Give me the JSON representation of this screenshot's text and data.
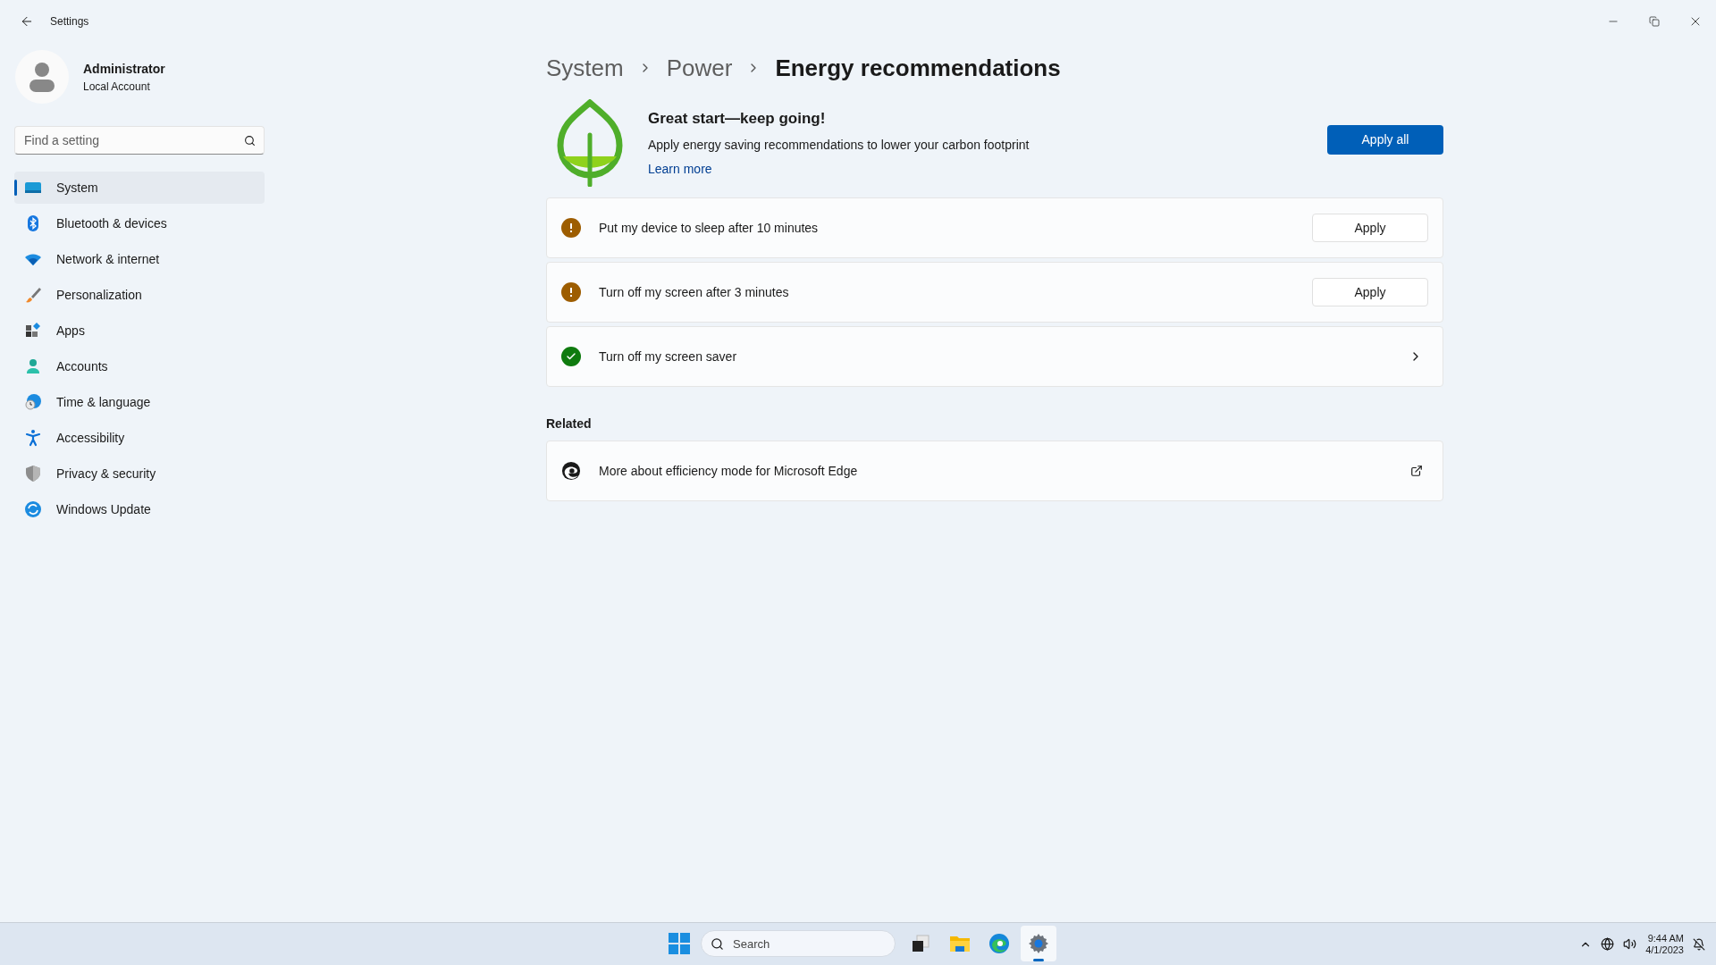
{
  "window": {
    "title": "Settings"
  },
  "user": {
    "name": "Administrator",
    "account_type": "Local Account"
  },
  "search": {
    "placeholder": "Find a setting"
  },
  "sidebar": {
    "items": [
      {
        "label": "System",
        "kind": "system",
        "selected": true
      },
      {
        "label": "Bluetooth & devices",
        "kind": "bluetooth",
        "selected": false
      },
      {
        "label": "Network & internet",
        "kind": "network",
        "selected": false
      },
      {
        "label": "Personalization",
        "kind": "personalization",
        "selected": false
      },
      {
        "label": "Apps",
        "kind": "apps",
        "selected": false
      },
      {
        "label": "Accounts",
        "kind": "accounts",
        "selected": false
      },
      {
        "label": "Time & language",
        "kind": "time",
        "selected": false
      },
      {
        "label": "Accessibility",
        "kind": "accessibility",
        "selected": false
      },
      {
        "label": "Privacy & security",
        "kind": "privacy",
        "selected": false
      },
      {
        "label": "Windows Update",
        "kind": "update",
        "selected": false
      }
    ]
  },
  "breadcrumb": [
    "System",
    "Power",
    "Energy recommendations"
  ],
  "banner": {
    "title": "Great start—keep going!",
    "description": "Apply energy saving recommendations to lower your carbon footprint",
    "link": "Learn more",
    "button": "Apply all"
  },
  "recommendations": [
    {
      "label": "Put my device to sleep after 10 minutes",
      "applied": false,
      "button": "Apply"
    },
    {
      "label": "Turn off my screen after 3 minutes",
      "applied": false,
      "button": "Apply"
    },
    {
      "label": "Turn off my screen saver",
      "applied": true
    }
  ],
  "related": {
    "heading": "Related",
    "items": [
      {
        "label": "More about efficiency mode for Microsoft Edge"
      }
    ]
  },
  "taskbar": {
    "search_placeholder": "Search",
    "apps": [
      {
        "kind": "taskview",
        "selected": false
      },
      {
        "kind": "explorer",
        "selected": false
      },
      {
        "kind": "edge",
        "selected": false
      },
      {
        "kind": "settings",
        "selected": true
      }
    ],
    "time": "9:44 AM",
    "date": "4/1/2023"
  }
}
